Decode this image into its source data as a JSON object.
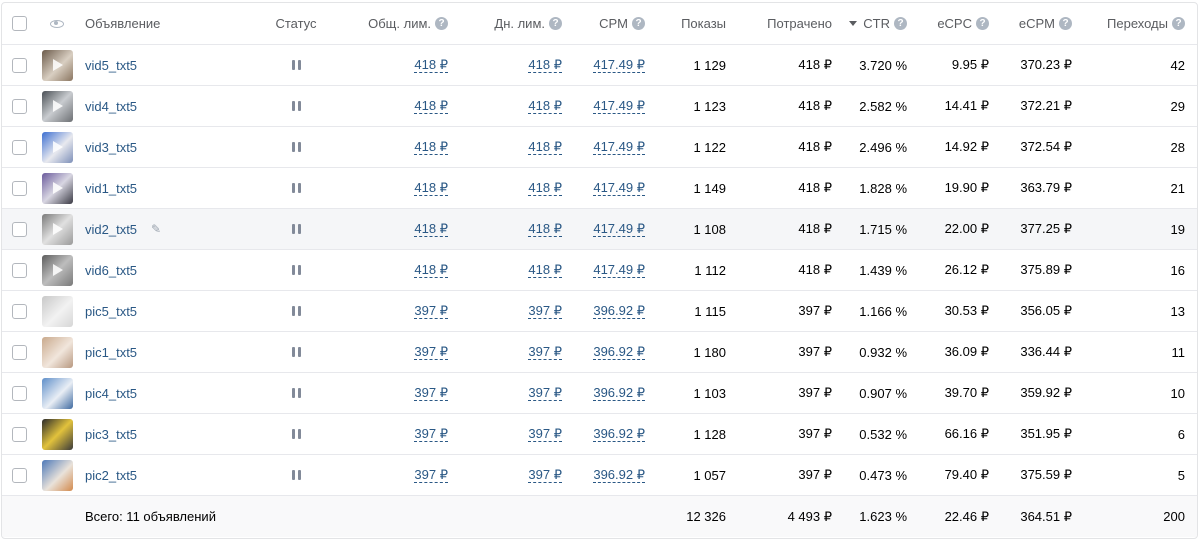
{
  "header": {
    "ad": "Объявление",
    "status": "Статус",
    "total_limit": "Общ. лим.",
    "daily_limit": "Дн. лим.",
    "cpm": "CPM",
    "impressions": "Показы",
    "spent": "Потрачено",
    "ctr": "CTR",
    "ecpc": "eCPC",
    "ecpm": "eCPM",
    "clicks": "Переходы",
    "help_glyph": "?"
  },
  "colors": {
    "link": "#2a5885",
    "border": "#e7e8ec",
    "hover_row": "#f5f6f8"
  },
  "rows": [
    {
      "name": "vid5_txt5",
      "total": "418 ₽",
      "daily": "418 ₽",
      "cpm": "417.49 ₽",
      "impr": "1 129",
      "spent": "418 ₽",
      "ctr": "3.720 %",
      "ecpc": "9.95 ₽",
      "ecpm": "370.23 ₽",
      "clicks": "42"
    },
    {
      "name": "vid4_txt5",
      "total": "418 ₽",
      "daily": "418 ₽",
      "cpm": "417.49 ₽",
      "impr": "1 123",
      "spent": "418 ₽",
      "ctr": "2.582 %",
      "ecpc": "14.41 ₽",
      "ecpm": "372.21 ₽",
      "clicks": "29"
    },
    {
      "name": "vid3_txt5",
      "total": "418 ₽",
      "daily": "418 ₽",
      "cpm": "417.49 ₽",
      "impr": "1 122",
      "spent": "418 ₽",
      "ctr": "2.496 %",
      "ecpc": "14.92 ₽",
      "ecpm": "372.54 ₽",
      "clicks": "28"
    },
    {
      "name": "vid1_txt5",
      "total": "418 ₽",
      "daily": "418 ₽",
      "cpm": "417.49 ₽",
      "impr": "1 149",
      "spent": "418 ₽",
      "ctr": "1.828 %",
      "ecpc": "19.90 ₽",
      "ecpm": "363.79 ₽",
      "clicks": "21"
    },
    {
      "name": "vid2_txt5",
      "total": "418 ₽",
      "daily": "418 ₽",
      "cpm": "417.49 ₽",
      "impr": "1 108",
      "spent": "418 ₽",
      "ctr": "1.715 %",
      "ecpc": "22.00 ₽",
      "ecpm": "377.25 ₽",
      "clicks": "19"
    },
    {
      "name": "vid6_txt5",
      "total": "418 ₽",
      "daily": "418 ₽",
      "cpm": "417.49 ₽",
      "impr": "1 112",
      "spent": "418 ₽",
      "ctr": "1.439 %",
      "ecpc": "26.12 ₽",
      "ecpm": "375.89 ₽",
      "clicks": "16"
    },
    {
      "name": "pic5_txt5",
      "total": "397 ₽",
      "daily": "397 ₽",
      "cpm": "396.92 ₽",
      "impr": "1 115",
      "spent": "397 ₽",
      "ctr": "1.166 %",
      "ecpc": "30.53 ₽",
      "ecpm": "356.05 ₽",
      "clicks": "13"
    },
    {
      "name": "pic1_txt5",
      "total": "397 ₽",
      "daily": "397 ₽",
      "cpm": "396.92 ₽",
      "impr": "1 180",
      "spent": "397 ₽",
      "ctr": "0.932 %",
      "ecpc": "36.09 ₽",
      "ecpm": "336.44 ₽",
      "clicks": "11"
    },
    {
      "name": "pic4_txt5",
      "total": "397 ₽",
      "daily": "397 ₽",
      "cpm": "396.92 ₽",
      "impr": "1 103",
      "spent": "397 ₽",
      "ctr": "0.907 %",
      "ecpc": "39.70 ₽",
      "ecpm": "359.92 ₽",
      "clicks": "10"
    },
    {
      "name": "pic3_txt5",
      "total": "397 ₽",
      "daily": "397 ₽",
      "cpm": "396.92 ₽",
      "impr": "1 128",
      "spent": "397 ₽",
      "ctr": "0.532 %",
      "ecpc": "66.16 ₽",
      "ecpm": "351.95 ₽",
      "clicks": "6"
    },
    {
      "name": "pic2_txt5",
      "total": "397 ₽",
      "daily": "397 ₽",
      "cpm": "396.92 ₽",
      "impr": "1 057",
      "spent": "397 ₽",
      "ctr": "0.473 %",
      "ecpc": "79.40 ₽",
      "ecpm": "375.59 ₽",
      "clicks": "5"
    }
  ],
  "footer": {
    "label": "Всего: 11 объявлений",
    "impr": "12 326",
    "spent": "4 493 ₽",
    "ctr": "1.623 %",
    "ecpc": "22.46 ₽",
    "ecpm": "364.51 ₽",
    "clicks": "200"
  }
}
